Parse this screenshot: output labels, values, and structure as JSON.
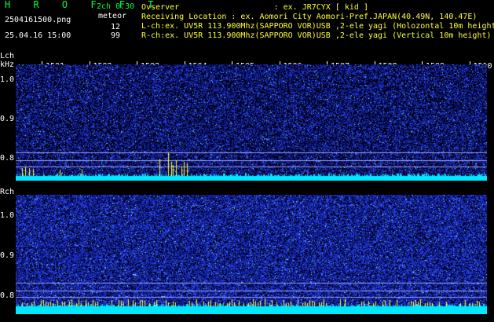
{
  "header": {
    "app_title": "H R O F F T",
    "version": "2ch 0.30",
    "filename": "2504161500.png",
    "datetime": "25.04.16 15:00",
    "meteor_label": "meteor",
    "count_lch": "12",
    "count_rch": "99",
    "observer": "Ovserver                    : ex. JR7CYX [ kid ]",
    "location": "Receiving Location : ex. Aomori City Aomori-Pref.JAPAN(40.49N, 140.47E)",
    "lch_info": "L-ch:ex. UV5R 113.900Mhz(SAPPORO VOR)USB ,2-ele yagi (Holozontal 10m height",
    "rch_info": "R-ch:ex. UV5R 113.900Mhz(SAPPORO VOR)USB ,2-ele yagi (Vertical 10m height)"
  },
  "axis": {
    "lch_label": "Lch",
    "khz_label": "kHz",
    "rch_label": "Rch",
    "x_ticks": [
      "1501",
      "1502",
      "1503",
      "1504",
      "1505",
      "1506",
      "1507",
      "1508",
      "1509",
      "1510"
    ],
    "y_ticks_l": [
      "1.0",
      "0.9",
      "0.8"
    ],
    "y_ticks_r": [
      "1.0",
      "0.9",
      "0.8"
    ]
  },
  "colors": {
    "background": "#000000",
    "label_green": "#00ff40",
    "text_white": "#ffffff",
    "noise_blue": "#1a2cff",
    "baseline_cyan": "#00e8ff",
    "spike_yellow": "#ffff33"
  }
}
